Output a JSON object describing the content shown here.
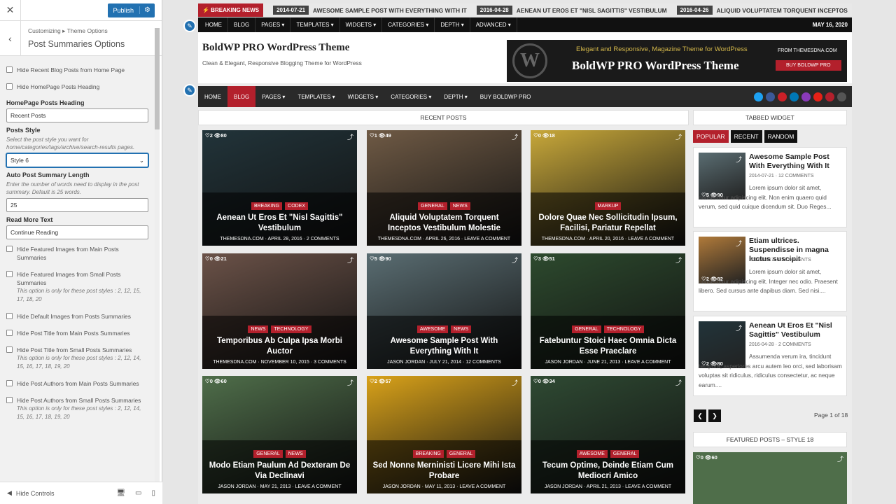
{
  "customizer": {
    "publish": "Publish",
    "breadcrumb_root": "Customizing",
    "breadcrumb_sep": "▸",
    "breadcrumb_parent": "Theme Options",
    "section_title": "Post Summaries Options",
    "opt_hide_recent": "Hide Recent Blog Posts from Home Page",
    "opt_hide_heading": "Hide HomePage Posts Heading",
    "heading_label": "HomePage Posts Heading",
    "heading_value": "Recent Posts",
    "style_label": "Posts Style",
    "style_desc": "Select the post style you want for home/categories/tags/archive/search-results pages.",
    "style_value": "Style 6",
    "length_label": "Auto Post Summary Length",
    "length_desc": "Enter the number of words need to display in the post summary. Default is 25 words.",
    "length_value": "25",
    "readmore_label": "Read More Text",
    "readmore_value": "Continue Reading",
    "opt_feat_main": "Hide Featured Images from Main Posts Summaries",
    "opt_feat_small": "Hide Featured Images from Small Posts Summaries",
    "opt_feat_small_note": "This option is only for these post styles : 2, 12, 15, 17, 18, 20",
    "opt_default_img": "Hide Default Images from Posts Summaries",
    "opt_title_main": "Hide Post Title from Main Posts Summaries",
    "opt_title_small": "Hide Post Title from Small Posts Summaries",
    "opt_title_small_note": "This option is only for these post styles : 2, 12, 14, 15, 16, 17, 18, 19, 20",
    "opt_auth_main": "Hide Post Authors from Main Posts Summaries",
    "opt_auth_small": "Hide Post Authors from Small Posts Summaries",
    "opt_auth_small_note": "This option is only for these post styles : 2, 12, 14, 15, 16, 17, 18, 19, 20",
    "hide_controls": "Hide Controls"
  },
  "breaking": {
    "label": "BREAKING NEWS",
    "items": [
      {
        "date": "2014-07-21",
        "title": "AWESOME SAMPLE POST WITH EVERYTHING WITH IT"
      },
      {
        "date": "2016-04-28",
        "title": "AENEAN UT EROS ET \"NISL SAGITTIS\" VESTIBULUM"
      },
      {
        "date": "2016-04-26",
        "title": "ALIQUID VOLUPTATEM TORQUENT INCEPTOS"
      }
    ]
  },
  "topnav": {
    "items": [
      "Home",
      "Blog",
      "Pages ▾",
      "Templates ▾",
      "Widgets ▾",
      "Categories ▾",
      "Depth ▾",
      "Advanced ▾"
    ],
    "date": "MAY 16, 2020"
  },
  "header": {
    "site_title": "BoldWP PRO WordPress Theme",
    "tagline": "Clean & Elegant, Responsive Blogging Theme for WordPress",
    "banner_logo": "W",
    "banner_line1": "Elegant and Responsive, Magazine Theme for WordPress",
    "banner_line2": "BoldWP PRO WordPress Theme",
    "banner_from": "FROM THEMESDNA.COM",
    "banner_btn": "BUY BOLDWP PRO"
  },
  "mainnav": {
    "items": [
      "Home",
      "Blog",
      "Pages ▾",
      "Templates ▾",
      "Widgets ▾",
      "Categories ▾",
      "Depth ▾",
      "Buy BoldWP Pro"
    ],
    "social_colors": [
      "#1da1f2",
      "#3b5998",
      "#cb2027",
      "#0077b5",
      "#8a3ab9",
      "#e62117",
      "#b3202c",
      "#555555"
    ]
  },
  "recent_heading": "RECENT POSTS",
  "posts": [
    {
      "stats": "♡2 👁80",
      "cats": [
        "Breaking",
        "Codex"
      ],
      "title": "Aenean Ut Eros Et \"Nisl Sagittis\" Vestibulum",
      "meta": "THEMESDNA.COM · APRIL 28, 2016 · 2 COMMENTS",
      "bg": "#22343a"
    },
    {
      "stats": "♡1 👁49",
      "cats": [
        "General",
        "News"
      ],
      "title": "Aliquid Voluptatem Torquent Inceptos Vestibulum Molestie",
      "meta": "THEMESDNA.COM · APRIL 26, 2016 · LEAVE A COMMENT",
      "bg": "#6f5a45"
    },
    {
      "stats": "♡0 👁18",
      "cats": [
        "Markup"
      ],
      "title": "Dolore Quae Nec Sollicitudin Ipsum, Facilisi, Pariatur Repellat",
      "meta": "THEMESDNA.COM · APRIL 20, 2016 · LEAVE A COMMENT",
      "bg": "#c8a83a"
    },
    {
      "stats": "♡0 👁21",
      "cats": [
        "News",
        "Technology"
      ],
      "title": "Temporibus Ab Culpa Ipsa Morbi Auctor",
      "meta": "THEMESDNA.COM · NOVEMBER 10, 2015 · 3 COMMENTS",
      "bg": "#6b5248"
    },
    {
      "stats": "♡5 👁90",
      "cats": [
        "Awesome",
        "News"
      ],
      "title": "Awesome Sample Post With Everything With It",
      "meta": "JASON JORDAN · JULY 21, 2014 · 12 COMMENTS",
      "bg": "#5a6d72"
    },
    {
      "stats": "♡3 👁51",
      "cats": [
        "General",
        "Technology"
      ],
      "title": "Fatebuntur Stoici Haec Omnia Dicta Esse Praeclare",
      "meta": "JASON JORDAN · JUNE 21, 2013 · LEAVE A COMMENT",
      "bg": "#2d4a2e"
    },
    {
      "stats": "♡0 👁60",
      "cats": [
        "General",
        "News"
      ],
      "title": "Modo Etiam Paulum Ad Dexteram De Via Declinavi",
      "meta": "JASON JORDAN · MAY 21, 2013 · LEAVE A COMMENT",
      "bg": "#4f6e4a"
    },
    {
      "stats": "♡2 👁57",
      "cats": [
        "Breaking",
        "General"
      ],
      "title": "Sed Nonne Merninisti Licere Mihi Ista Probare",
      "meta": "JASON JORDAN · MAY 11, 2013 · LEAVE A COMMENT",
      "bg": "#d9a21a"
    },
    {
      "stats": "♡0 👁34",
      "cats": [
        "Awesome",
        "General"
      ],
      "title": "Tecum Optime, Deinde Etiam Cum Mediocri Amico",
      "meta": "JASON JORDAN · APRIL 21, 2013 · LEAVE A COMMENT",
      "bg": "#2f4a33"
    }
  ],
  "sidebar": {
    "tabbed_heading": "TABBED WIDGET",
    "tabs": [
      "Popular",
      "Recent",
      "Random"
    ],
    "items": [
      {
        "title": "Awesome Sample Post With Everything With It",
        "meta": "2014-07-21 · 12 COMMENTS",
        "stats": "♡5 👁90",
        "excerpt": "Lorem ipsum dolor sit amet, consectetur adipiscing elit. Non enim quaero quid verum, sed quid cuique dicendum sit. Duo Reges...",
        "bg": "#5a6d72"
      },
      {
        "title": "Etiam ultrices. Suspendisse in magna luctus suscipit",
        "meta": "2013-03-17 · 0 COMMENTS",
        "stats": "♡2 👁82",
        "excerpt": "Lorem ipsum dolor sit amet, consectetur adipiscing elit. Integer nec odio. Praesent libero. Sed cursus ante dapibus diam. Sed nisi....",
        "bg": "#b07a3a"
      },
      {
        "title": "Aenean Ut Eros Et \"Nisl Sagittis\" Vestibulum",
        "meta": "2016-04-28 · 2 COMMENTS",
        "stats": "♡2 👁80",
        "excerpt": "Assumenda verum ira, tincidunt tempora, asperiores arcu autem leo orci, sed laborisam voluptas sit ridiculus, ridiculus consectetur, ac neque earum....",
        "bg": "#22343a"
      }
    ],
    "page_text": "Page 1 of 18",
    "featured_heading": "FEATURED POSTS – STYLE 18",
    "featured_stats": "♡0 👁60"
  }
}
